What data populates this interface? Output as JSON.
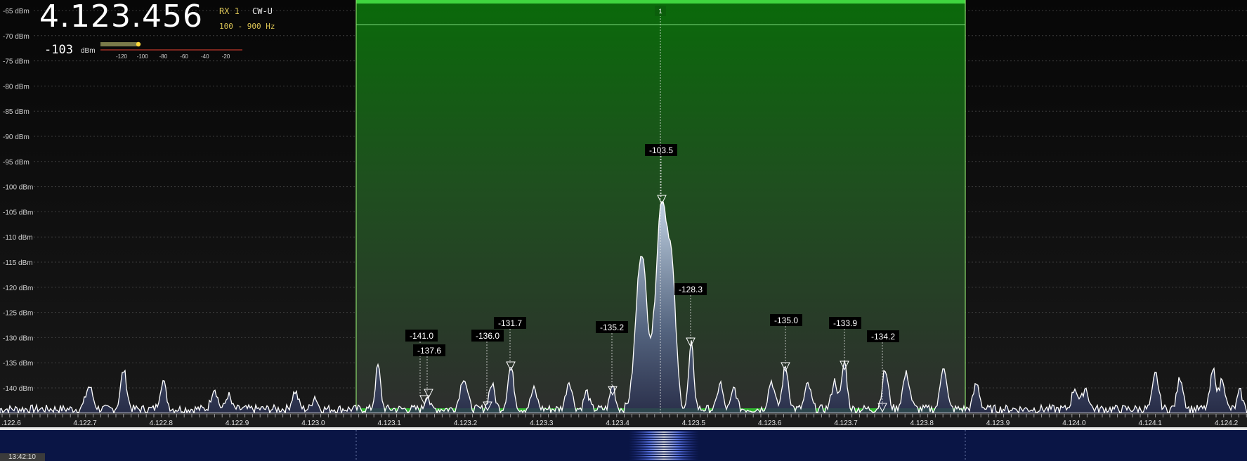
{
  "app": {
    "frequency": "4.123.456",
    "receiver": "RX 1",
    "mode": "CW-U",
    "filter": "100 - 900 Hz",
    "signal_value": "-103",
    "signal_unit": "dBm",
    "smeter_ticks": [
      "-120",
      "-100",
      "-80",
      "-60",
      "-40",
      "-20"
    ],
    "smeter_level_dbm": -103,
    "time": "13:42:10"
  },
  "spectrum": {
    "y_labels": [
      "-65 dBm",
      "-70 dBm",
      "-75 dBm",
      "-80 dBm",
      "-85 dBm",
      "-90 dBm",
      "-95 dBm",
      "-100 dBm",
      "-105 dBm",
      "-110 dBm",
      "-115 dBm",
      "-120 dBm",
      "-125 dBm",
      "-130 dBm",
      "-135 dBm",
      "-140 dBm"
    ],
    "x_labels": [
      ".122.6",
      "4.122.7",
      "4.122.8",
      "4.122.9",
      "4.123.0",
      "4.123.1",
      "4.123.2",
      "4.123.3",
      "4.123.4",
      "4.123.5",
      "4.123.6",
      "4.123.7",
      "4.123.8",
      "4.123.9",
      "4.124.0",
      "4.124.1",
      "4.124.2"
    ],
    "x_range_mhz": [
      4.1226,
      4.12422
    ],
    "y_range_dbm": [
      -143,
      -63
    ],
    "filter_passband_mhz": [
      4.12306,
      4.12386
    ],
    "vfo_mhz": 4.12346,
    "vfo_marker": "1",
    "peak_markers": [
      {
        "label": "-141.0",
        "f": 4.123144,
        "v": -141.0
      },
      {
        "label": "-137.6",
        "f": 4.123154,
        "v": -137.6
      },
      {
        "label": "-136.0",
        "f": 4.123232,
        "v": -136.0
      },
      {
        "label": "-131.7",
        "f": 4.123261,
        "v": -131.7
      },
      {
        "label": "-135.2",
        "f": 4.123404,
        "v": -135.2
      },
      {
        "label": "-103.5",
        "f": 4.123462,
        "v": -103.5
      },
      {
        "label": "-128.3",
        "f": 4.123501,
        "v": -128.3
      },
      {
        "label": "-135.0",
        "f": 4.123626,
        "v": -135.0
      },
      {
        "label": "-133.9",
        "f": 4.123703,
        "v": -133.9
      },
      {
        "label": "-134.2",
        "f": 4.12375,
        "v": -134.2
      }
    ],
    "colors": {
      "background": "#0c0c0c",
      "passband_top": "#0c7f0c",
      "passband_bottom": "#2e2e2e",
      "passband_edge": "#8bdc6b",
      "trace": "#ffffff",
      "grid": "#3c3c3c",
      "waterfall": "#0a1545"
    }
  }
}
